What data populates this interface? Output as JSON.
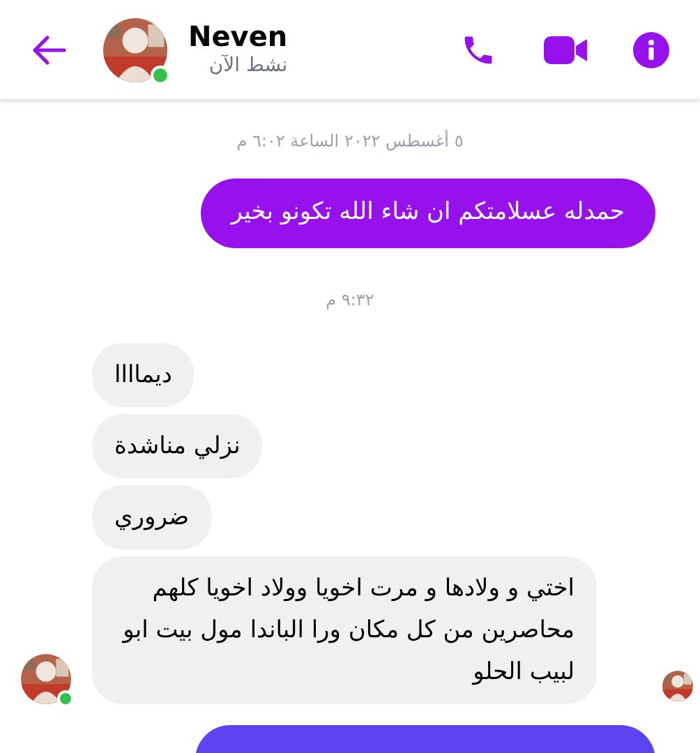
{
  "header": {
    "name": "Neven",
    "status": "نشط الآن",
    "online": true
  },
  "timeline": [
    {
      "kind": "timestamp",
      "text": "٥ أغسطس ٢٠٢٢ الساعة ٦:٠٢ م"
    },
    {
      "kind": "outgoing",
      "text": "حمدله عسلامتكم ان شاء الله تكونو بخير",
      "color": "#9611ec"
    },
    {
      "kind": "timestamp",
      "text": "٩:٣٢ م"
    },
    {
      "kind": "incoming_group",
      "messages": [
        "ديماااا",
        "نزلي مناشدة",
        "ضروري",
        "اختي و ولادها و مرت اخويا وولاد اخويا كلهم محاصرين من كل مكان ورا الباندا مول بيت ابو لبيب الحلو"
      ],
      "online": true,
      "seen": true
    },
    {
      "kind": "outgoing",
      "color": "#5a45f0"
    }
  ]
}
